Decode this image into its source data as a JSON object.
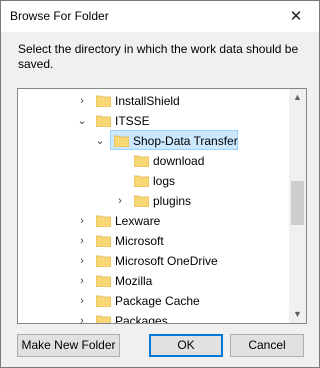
{
  "dialog": {
    "title": "Browse For Folder",
    "instruction": "Select the directory in which the work data should be saved."
  },
  "tree": {
    "items": [
      {
        "label": "InstallShield",
        "expander": "collapsed"
      },
      {
        "label": "ITSSE",
        "expander": "expanded"
      },
      {
        "label": "Shop-Data Transfer",
        "expander": "expanded",
        "selected": true
      },
      {
        "label": "download",
        "expander": "none"
      },
      {
        "label": "logs",
        "expander": "none"
      },
      {
        "label": "plugins",
        "expander": "collapsed"
      },
      {
        "label": "Lexware",
        "expander": "collapsed"
      },
      {
        "label": "Microsoft",
        "expander": "collapsed"
      },
      {
        "label": "Microsoft OneDrive",
        "expander": "collapsed"
      },
      {
        "label": "Mozilla",
        "expander": "collapsed"
      },
      {
        "label": "Package Cache",
        "expander": "collapsed"
      },
      {
        "label": "Packages",
        "expander": "collapsed"
      }
    ]
  },
  "buttons": {
    "new_folder": "Make New Folder",
    "ok": "OK",
    "cancel": "Cancel"
  },
  "colors": {
    "selection": "#cce8ff",
    "folder": "#f8d775",
    "accent": "#0078d7"
  }
}
